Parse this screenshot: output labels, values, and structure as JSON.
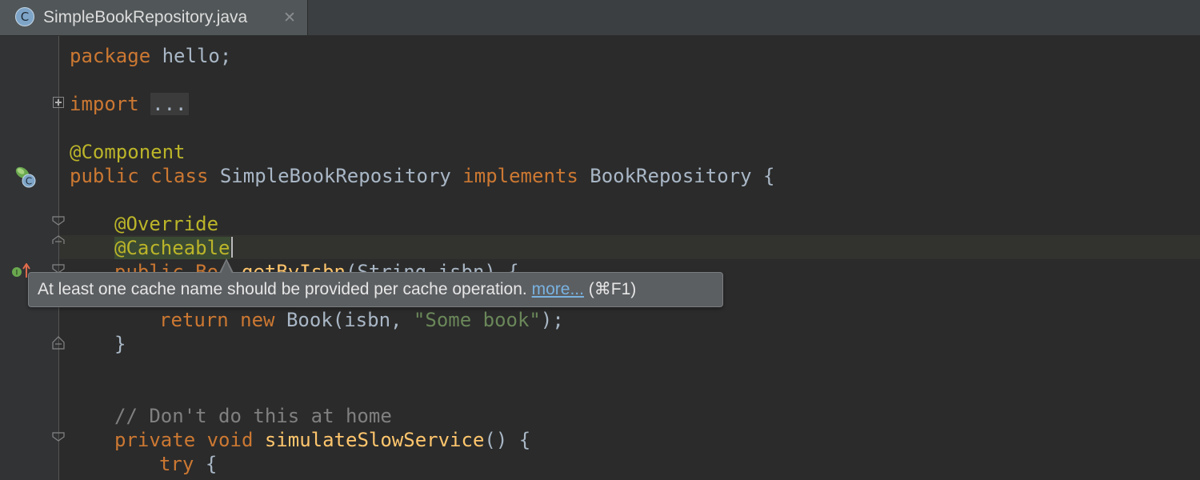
{
  "tab": {
    "icon_letter": "C",
    "filename": "SimpleBookRepository.java",
    "close_glyph": "✕"
  },
  "code": {
    "line_package_kw": "package",
    "line_package_name": " hello;",
    "line_import_kw": "import",
    "line_import_fold": "...",
    "line_component": "@Component",
    "line_class_public": "public",
    "line_class_class": "class",
    "line_class_name": "SimpleBookRepository",
    "line_class_implements": "implements",
    "line_class_iface": "BookRepository {",
    "line_override": "@Override",
    "line_cacheable": "@Cacheable",
    "line_method_partial": "public Bo",
    "line_method_name": "getByIsbn",
    "line_method_params": "(String isbn) {",
    "line_return_kw1": "return",
    "line_return_kw2": "new",
    "line_return_call": "Book(isbn,",
    "line_return_str": "\"Some book\"",
    "line_return_end": ");",
    "line_close_brace": "}",
    "line_comment": "// Don't do this at home",
    "line_private_kw": "private",
    "line_void_kw": "void",
    "line_slow_name": "simulateSlowService",
    "line_slow_end": "() {",
    "line_try_kw": "try",
    "line_try_brace": "{"
  },
  "tooltip": {
    "message": "At least one cache name should be provided per cache operation.",
    "link": "more...",
    "shortcut": "(⌘F1)"
  },
  "colors": {
    "keyword": "#cc7832",
    "annotation": "#bbb529",
    "function": "#ffc66d",
    "string": "#6a8759",
    "comment": "#808080",
    "text": "#a9b7c6",
    "background": "#2b2b2b",
    "link": "#79b2e0"
  },
  "icons": {
    "tab": "java-class-icon",
    "gutter_bean": "spring-bean-class-icon",
    "gutter_impl": "implementing-method-icon",
    "fold": "fold-icon"
  }
}
